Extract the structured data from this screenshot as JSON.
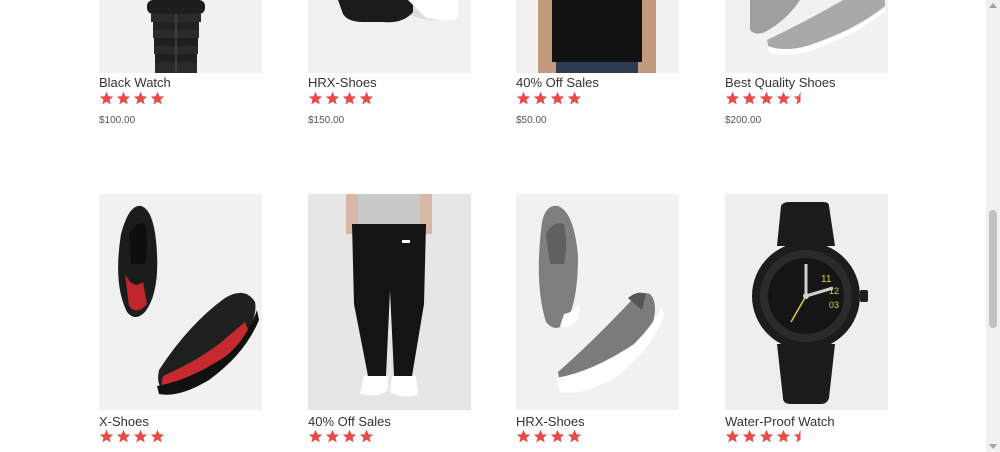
{
  "products": [
    {
      "title": "Black Watch",
      "rating": 4,
      "price": "$100.00",
      "image_icon": "watch-bracelet-icon"
    },
    {
      "title": "HRX-Shoes",
      "rating": 4,
      "price": "$150.00",
      "image_icon": "socks-icon"
    },
    {
      "title": "40% Off Sales",
      "rating": 4,
      "price": "$50.00",
      "image_icon": "tshirt-icon"
    },
    {
      "title": "Best Quality Shoes",
      "rating": 4.5,
      "price": "$200.00",
      "image_icon": "grey-shoe-icon"
    },
    {
      "title": "X-Shoes",
      "rating": 4,
      "price": "",
      "image_icon": "sport-shoes-icon"
    },
    {
      "title": "40% Off Sales",
      "rating": 4,
      "price": "",
      "image_icon": "joggers-icon"
    },
    {
      "title": "HRX-Shoes",
      "rating": 4,
      "price": "",
      "image_icon": "slip-on-shoes-icon"
    },
    {
      "title": "Water-Proof Watch",
      "rating": 4.5,
      "price": "",
      "image_icon": "wrist-watch-icon"
    }
  ],
  "colors": {
    "star": "#e94b45",
    "image_bg": "#f1f1f1"
  }
}
